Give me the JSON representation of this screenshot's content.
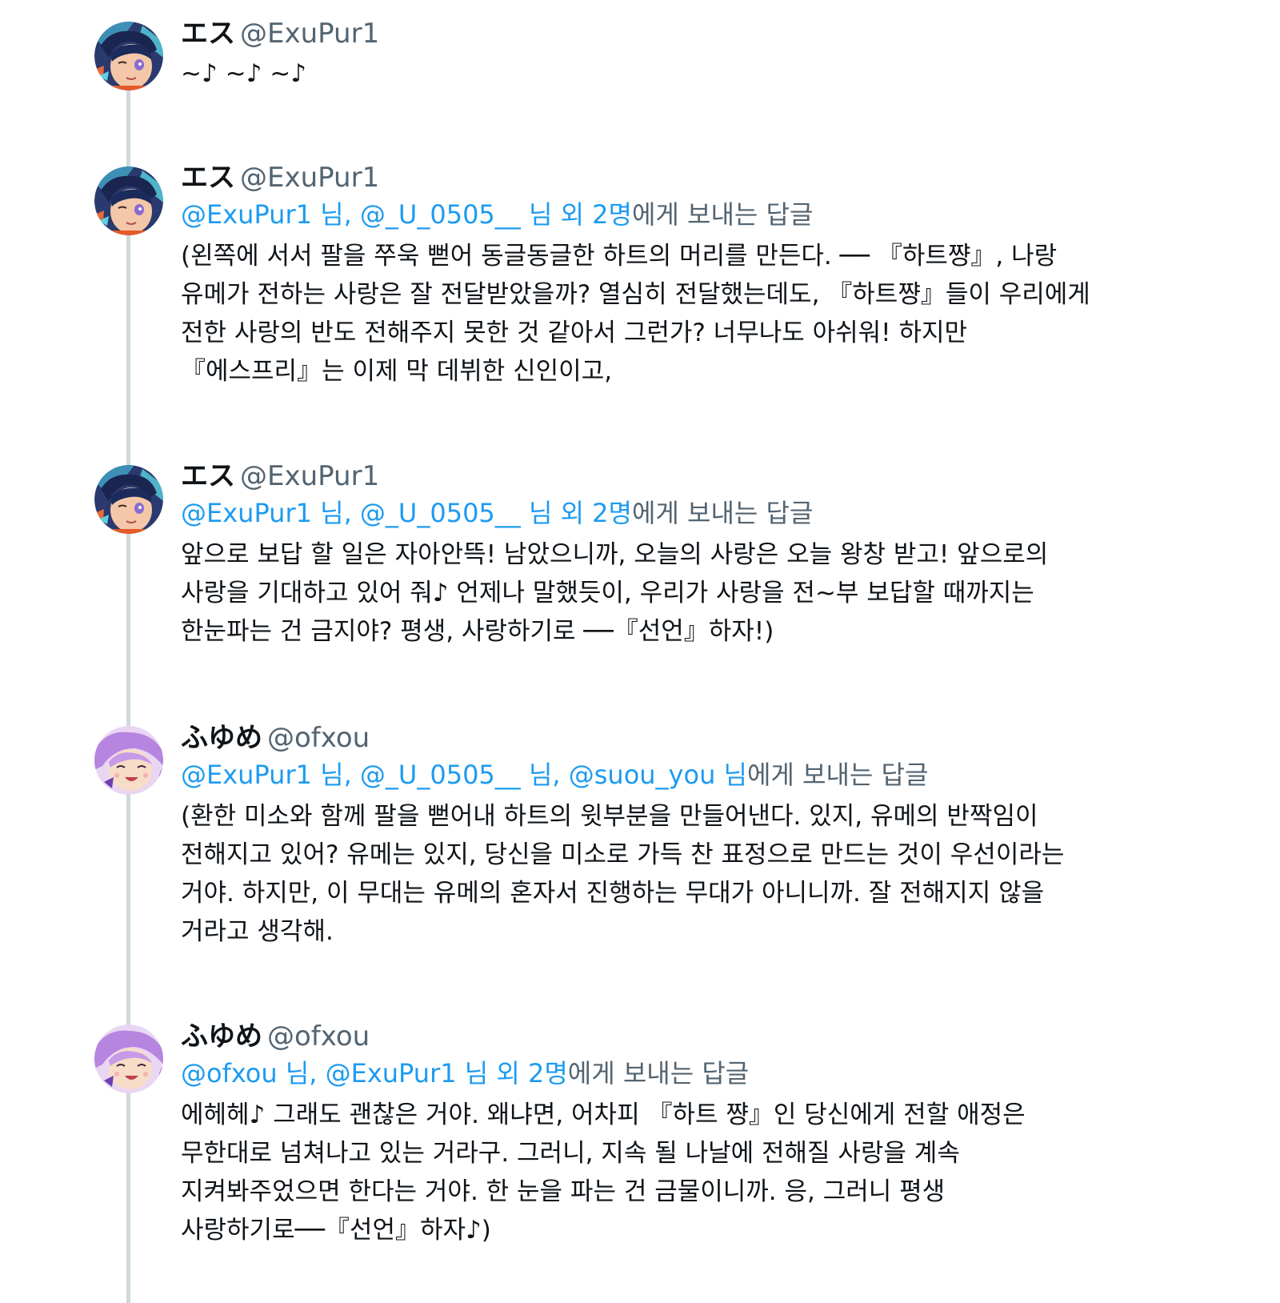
{
  "colors": {
    "link": "#1d9bf0",
    "secondary_text": "#536471",
    "primary_text": "#0f1419",
    "thread_line": "#cfd9de",
    "background": "#ffffff"
  },
  "tweets": [
    {
      "author_name": "エス",
      "author_handle": "@ExuPur1",
      "avatar": "avatar-esu",
      "reply_mentions": "",
      "reply_suffix": "",
      "lines": [
        "~♪ ~♪ ~♪"
      ]
    },
    {
      "author_name": "エス",
      "author_handle": "@ExuPur1",
      "avatar": "avatar-esu",
      "reply_mentions": "@ExuPur1 님, @_U_0505__ 님 외 2명",
      "reply_suffix": "에게 보내는 답글",
      "lines": [
        "(왼쪽에 서서 팔을 쭈욱 뻗어 동글동글한 하트의 머리를 만든다. ── 『하트쨩』, 나랑",
        "유메가 전하는 사랑은 잘 전달받았을까? 열심히 전달했는데도, 『하트쨩』들이 우리에게",
        "전한 사랑의 반도 전해주지 못한 것 같아서 그런가? 너무나도 아쉬워! 하지만",
        "『에스프리』는 이제 막 데뷔한 신인이고,"
      ]
    },
    {
      "author_name": "エス",
      "author_handle": "@ExuPur1",
      "avatar": "avatar-esu",
      "reply_mentions": "@ExuPur1 님, @_U_0505__ 님 외 2명",
      "reply_suffix": "에게 보내는 답글",
      "lines": [
        "앞으로 보답 할 일은 자아안뜩! 남았으니까, 오늘의 사랑은 오늘 왕창 받고! 앞으로의",
        "사랑을 기대하고 있어 줘♪ 언제나 말했듯이, 우리가 사랑을 전~부 보답할 때까지는",
        "한눈파는 건 금지야? 평생, 사랑하기로 ──『선언』하자!)"
      ]
    },
    {
      "author_name": "ふゆめ",
      "author_handle": "@ofxou",
      "avatar": "avatar-fuyume",
      "reply_mentions": "@ExuPur1 님, @_U_0505__ 님, @suou_you 님",
      "reply_suffix": "에게 보내는 답글",
      "lines": [
        "(환한 미소와 함께 팔을 뻗어내 하트의 윗부분을 만들어낸다. 있지, 유메의 반짝임이",
        "전해지고 있어? 유메는 있지, 당신을 미소로 가득 찬 표정으로 만드는 것이 우선이라는",
        "거야. 하지만, 이 무대는 유메의 혼자서 진행하는 무대가 아니니까. 잘 전해지지 않을",
        "거라고 생각해."
      ]
    },
    {
      "author_name": "ふゆめ",
      "author_handle": "@ofxou",
      "avatar": "avatar-fuyume",
      "reply_mentions": "@ofxou 님, @ExuPur1 님 외 2명",
      "reply_suffix": "에게 보내는 답글",
      "lines": [
        "에헤헤♪ 그래도 괜찮은 거야. 왜냐면, 어차피 『하트 쨩』인 당신에게 전할 애정은",
        "무한대로 넘쳐나고 있는 거라구. 그러니, 지속 될 나날에 전해질 사랑을 계속",
        "지켜봐주었으면 한다는 거야. 한 눈을 파는 건 금물이니까. 응, 그러니 평생",
        "사랑하기로──『선언』하자♪)"
      ]
    }
  ]
}
